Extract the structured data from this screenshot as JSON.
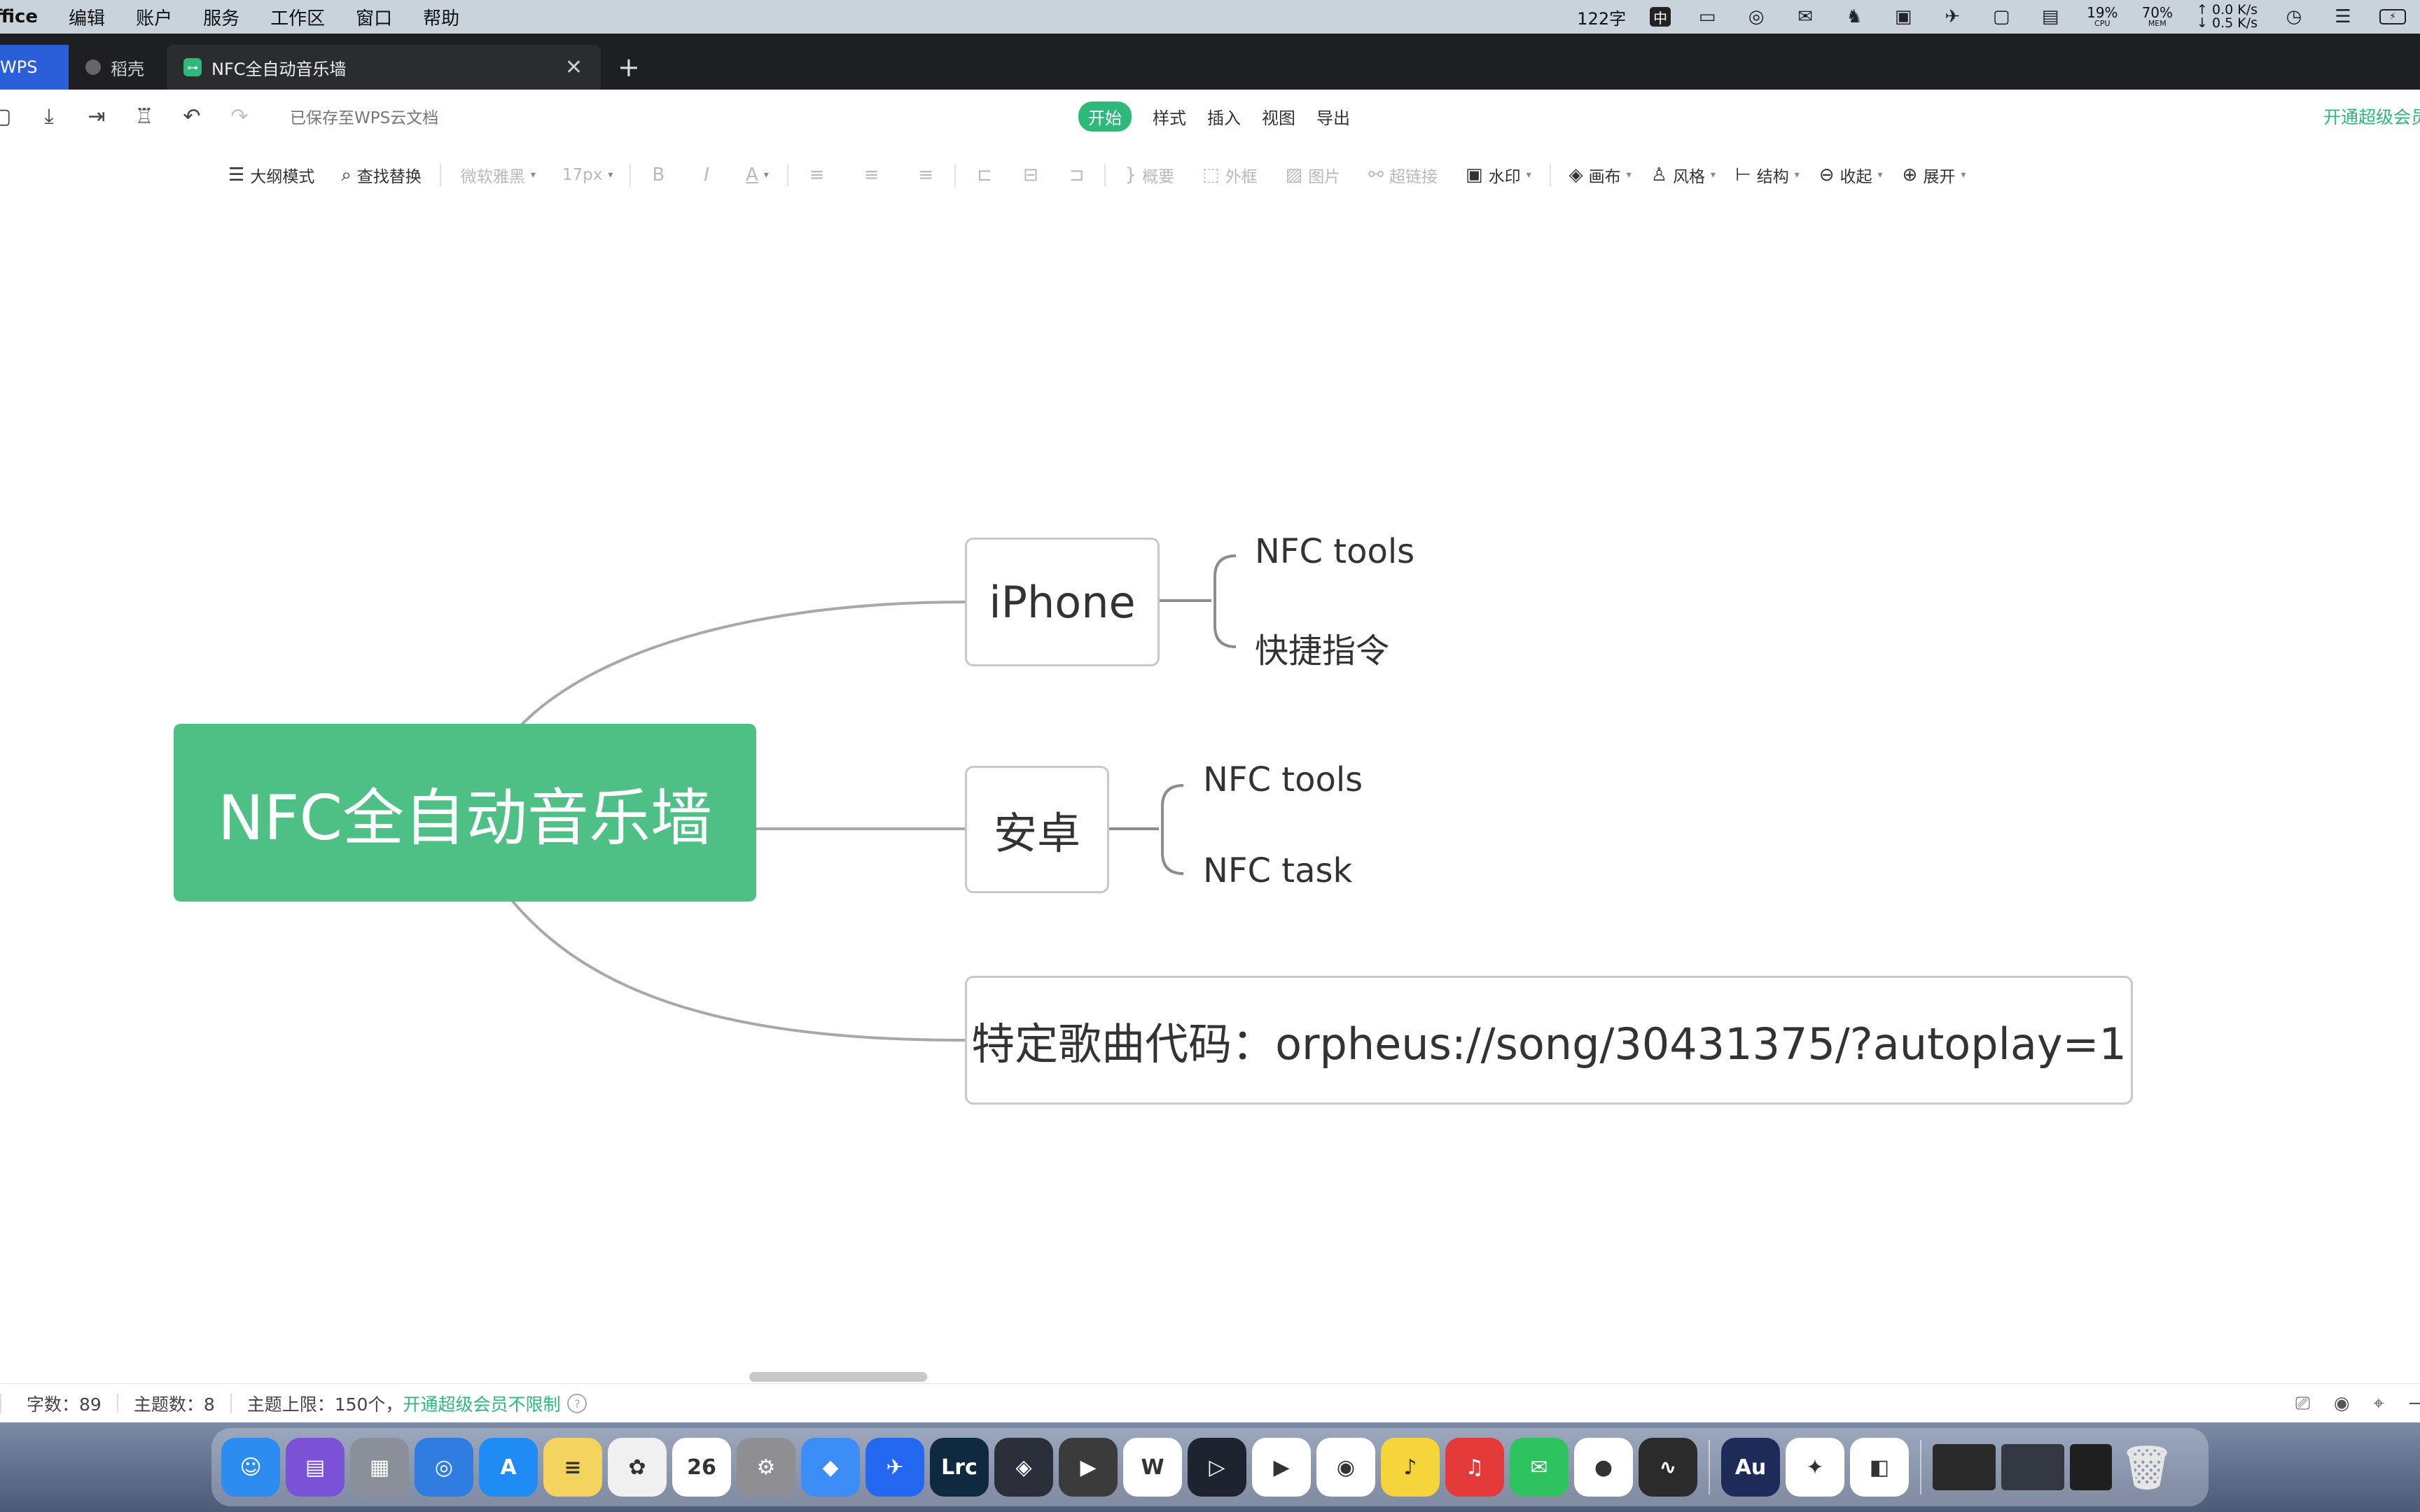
{
  "menubar": {
    "app_name": "ffice",
    "items": [
      "编辑",
      "账户",
      "服务",
      "工作区",
      "窗口",
      "帮助"
    ],
    "word_count": "122字",
    "input_method": "中",
    "cpu": {
      "value": "19%",
      "label": "CPU"
    },
    "mem": {
      "value": "70%",
      "label": "MEM"
    },
    "net_up": "↑ 0.0 K/s",
    "net_down": "↓ 0.5 K/s"
  },
  "tabs": {
    "wps_label": "WPS",
    "daoke_label": "稻壳",
    "active_label": "NFC全自动音乐墙",
    "add_label": "+"
  },
  "toolbar1": {
    "saved_text": "已保存至WPS云文档",
    "menu_tabs": [
      "开始",
      "样式",
      "插入",
      "视图",
      "导出"
    ],
    "vip_text": "开通超级会员"
  },
  "toolbar2": {
    "outline": "大纲模式",
    "find_replace": "查找替换",
    "font_name": "微软雅黑",
    "font_size": "17px",
    "bold": "B",
    "italic": "I",
    "font_color": "A",
    "summary": "概要",
    "frame": "外框",
    "image": "图片",
    "hyperlink": "超链接",
    "watermark": "水印",
    "canvas": "画布",
    "style": "风格",
    "structure": "结构",
    "collapse": "收起",
    "expand": "展开"
  },
  "mindmap": {
    "root": "NFC全自动音乐墙",
    "branches": [
      {
        "label": "iPhone",
        "children": [
          "NFC tools",
          "快捷指令"
        ]
      },
      {
        "label": "安卓",
        "children": [
          "NFC tools",
          "NFC task"
        ]
      },
      {
        "label": "特定歌曲代码：orpheus://song/30431375/?autoplay=1",
        "children": []
      }
    ],
    "root_color": "#4fc085",
    "line_color": "#a8a8a8"
  },
  "statusbar": {
    "word_count": "字数：89",
    "topic_count": "主题数：8",
    "topic_limit": "主题上限：150个，",
    "vip_unlimited": "开通超级会员不限制",
    "help": "?"
  },
  "dock": {
    "apps": [
      {
        "name": "finder",
        "color": "#2d8cf0",
        "glyph": "☺"
      },
      {
        "name": "calendar-app",
        "color": "#7b52d6",
        "glyph": "▤"
      },
      {
        "name": "launchpad",
        "color": "#8a8f99",
        "glyph": "▦"
      },
      {
        "name": "safari",
        "color": "#2f7de1",
        "glyph": "◎"
      },
      {
        "name": "app-store",
        "color": "#1f8bf5",
        "glyph": "A"
      },
      {
        "name": "notes",
        "color": "#f4d35e",
        "glyph": "≡"
      },
      {
        "name": "photos",
        "color": "#f0f0f0",
        "glyph": "✿"
      },
      {
        "name": "calendar",
        "color": "#ffffff",
        "glyph": "26"
      },
      {
        "name": "system-settings",
        "color": "#8e8e93",
        "glyph": "⚙"
      },
      {
        "name": "cat-app",
        "color": "#3c8df5",
        "glyph": "◆"
      },
      {
        "name": "feishu",
        "color": "#2468f2",
        "glyph": "✈"
      },
      {
        "name": "lightroom",
        "color": "#0f2940",
        "glyph": "Lrc"
      },
      {
        "name": "davinci",
        "color": "#2a2f3a",
        "glyph": "◈"
      },
      {
        "name": "final-cut",
        "color": "#3b3b3b",
        "glyph": "▶"
      },
      {
        "name": "wps",
        "color": "#ffffff",
        "glyph": "W"
      },
      {
        "name": "infuse",
        "color": "#1d2430",
        "glyph": "▷"
      },
      {
        "name": "infuse-orange",
        "color": "#ffffff",
        "glyph": "▶"
      },
      {
        "name": "chrome",
        "color": "#ffffff",
        "glyph": "◉"
      },
      {
        "name": "qq-music",
        "color": "#f6d43c",
        "glyph": "♪"
      },
      {
        "name": "netease-music",
        "color": "#e43a3a",
        "glyph": "♫"
      },
      {
        "name": "wechat",
        "color": "#2dc35e",
        "glyph": "✉"
      },
      {
        "name": "qq",
        "color": "#ffffff",
        "glyph": "●"
      },
      {
        "name": "voice-memo",
        "color": "#2b2b2b",
        "glyph": "∿"
      },
      {
        "name": "audition",
        "color": "#1e2b58",
        "glyph": "Au"
      },
      {
        "name": "mindnode",
        "color": "#ffffff",
        "glyph": "✦"
      },
      {
        "name": "nfc-doc",
        "color": "#ffffff",
        "glyph": "◧"
      }
    ]
  }
}
